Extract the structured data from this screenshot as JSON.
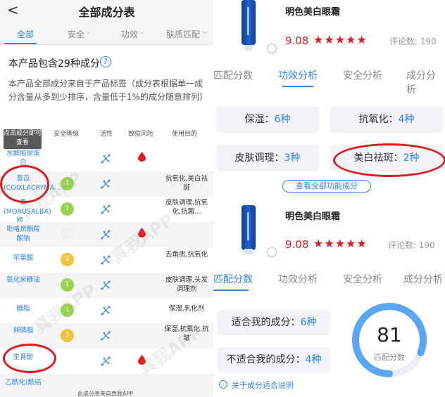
{
  "left": {
    "header": {
      "back": "<",
      "title": "全部成分表"
    },
    "tabs": [
      "全部",
      "安全",
      "功效",
      "肤质匹配"
    ],
    "count_text": "本产品包含29种成分",
    "help": "?",
    "description": "本产品全部成分来自于产品标签（成分表根据单一成分含量从多到少排序，含量低于1%的成分随意排列）",
    "tooltip": "点击成分即可查看",
    "columns": {
      "safety": "安全等级",
      "active": "活性",
      "acne": "致痘风险",
      "purpose": "使用目的"
    },
    "rows": [
      {
        "name": "水解胶原蛋白",
        "badge": "",
        "purpose": ""
      },
      {
        "name": "薏苡(COIXLACRYMA…",
        "badge": "1",
        "purpose": "抗氧化,美白祛斑"
      },
      {
        "name": "桑(MORUSALBA)根…",
        "badge": "1",
        "purpose": "皮肤调理,抗氧化,抗菌…"
      },
      {
        "name": "吡咯烷酮羧酸钠",
        "badge": "",
        "purpose": ""
      },
      {
        "name": "苹果酸",
        "badge": "3",
        "purpose": "去角质,抗氧化"
      },
      {
        "name": "氨化米糠油",
        "badge": "1",
        "purpose": "皮肤调理,头发调理剂"
      },
      {
        "name": "糖脂",
        "badge": "1",
        "purpose": "保湿,乳化剂"
      },
      {
        "name": "卵磷脂",
        "badge": "3",
        "purpose": "保湿,抗氧化,抗皱"
      },
      {
        "name": "生育酚",
        "badge": "",
        "purpose": ""
      },
      {
        "name": "乙酰化(酰结",
        "badge": "",
        "purpose": ""
      }
    ],
    "footer": "此成分表来自真我APP"
  },
  "right": {
    "product1": {
      "name": "明色美白眼霜",
      "score": "9.08",
      "stars": "★★★★★",
      "reviews": "评论数: 190"
    },
    "tabs1": [
      "匹配分数",
      "功效分析",
      "安全分析",
      "成分分析"
    ],
    "cards1": [
      {
        "label": "保湿：",
        "value": "6种"
      },
      {
        "label": "抗氧化：",
        "value": "4种"
      },
      {
        "label": "皮肤调理：",
        "value": "3种"
      },
      {
        "label": "美白祛斑：",
        "value": "2种"
      }
    ],
    "view_all": "查看全部功能成分",
    "product2": {
      "name": "明色美白眼霜",
      "score": "9.08",
      "stars": "★★★★★",
      "reviews": "评论数: 190"
    },
    "tabs2": [
      "匹配分数",
      "功效分析",
      "安全分析",
      "成分分析"
    ],
    "cards2": [
      {
        "label": "适合我的成分：",
        "value": "6种"
      },
      {
        "label": "不适合我的成分：",
        "value": "4种"
      }
    ],
    "gauge": {
      "value": "81",
      "label": "匹配分数",
      "fraction": 0.81
    },
    "about": "关于成分适合说明",
    "info": "i"
  },
  "colors": {
    "accent": "#2f86f6",
    "red": "#e4191f",
    "green": "#9ad34e",
    "yellow": "#f0c43a"
  }
}
